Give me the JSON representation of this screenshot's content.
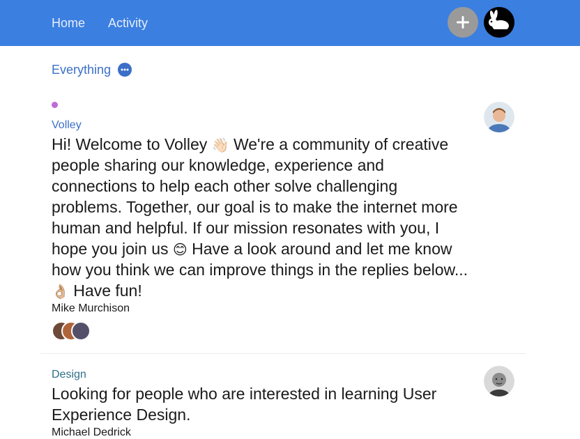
{
  "header": {
    "nav": [
      {
        "label": "Home"
      },
      {
        "label": "Activity"
      }
    ],
    "add_icon": "plus-icon",
    "avatar_icon": "rabbit-icon",
    "accent": "#3b7fe0"
  },
  "filter": {
    "label": "Everything",
    "more_icon": "ellipsis-icon"
  },
  "posts": [
    {
      "category": "Volley",
      "unread": true,
      "text_parts": [
        "Hi! Welcome to Volley ",
        "👋🏻",
        " We're a community of creative people sharing our knowledge, experience and connections to help each other solve challenging problems. Together, our goal is to make the internet more human and helpful. If our mission resonates with you, I hope you join us ",
        "😊",
        " Have a look around and let me know how you think we can improve things in the replies below... ",
        "👌🏼",
        " Have fun!"
      ],
      "author": "Mike Murchison",
      "reply_avatars": 3
    },
    {
      "category": "Design",
      "unread": false,
      "text": "Looking for people who are interested in learning User Experience Design.",
      "author": "Michael Dedrick"
    }
  ]
}
